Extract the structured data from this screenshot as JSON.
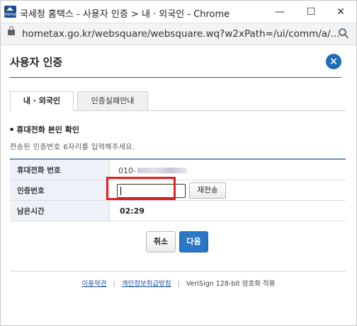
{
  "window": {
    "title": "국세청 홈택스 - 사용자 인증 > 내 · 외국인 - Chrome",
    "app_icon_text": "Home",
    "minimize": "—",
    "maximize": "☐",
    "close": "✕"
  },
  "address_bar": {
    "url": "hometax.go.kr/websquare/websquare.wq?w2xPath=/ui/comm/a/..."
  },
  "dialog": {
    "title": "사용자 인증",
    "close_label": "×"
  },
  "tabs": [
    {
      "label": "내 · 외국인",
      "active": true
    },
    {
      "label": "인증실패안내",
      "active": false
    }
  ],
  "section": {
    "title": "휴대전화 본인 확인",
    "guide": "전송된 인증번호 6자리를 입력해주세요."
  },
  "form": {
    "phone_label": "휴대전화 번호",
    "phone_prefix": "010-",
    "code_label": "인증번호",
    "code_value": "",
    "resend_label": "재전송",
    "remaining_label": "남은시간",
    "remaining_value": "02:29"
  },
  "buttons": {
    "cancel": "취소",
    "next": "다음"
  },
  "footer": {
    "terms": "이용약관",
    "privacy": "개인정보취급방침",
    "separator": "|",
    "verisign": "VeriSign 128-bit 암호화 적용"
  }
}
